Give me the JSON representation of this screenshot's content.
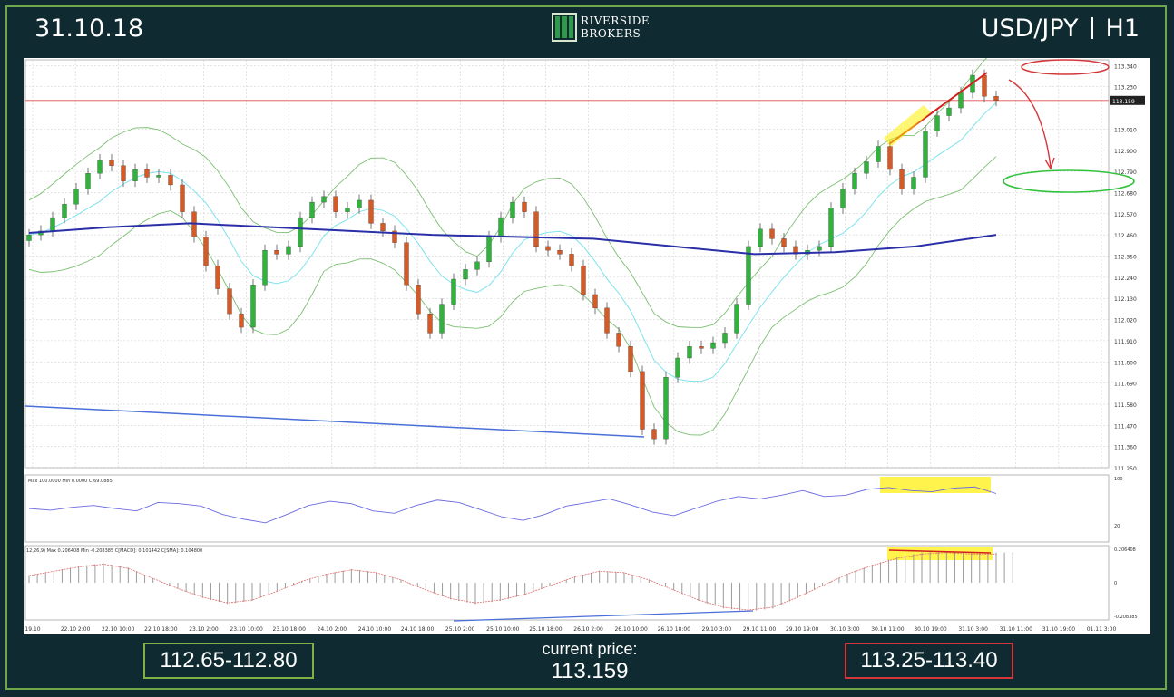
{
  "header": {
    "date": "31.10.18",
    "symbol": "USD/JPY",
    "timeframe": "H1"
  },
  "logo": {
    "line1": "RIVERSIDE",
    "line2": "BROKERS"
  },
  "footer": {
    "support_range": "112.65-112.80",
    "current_label": "current price:",
    "current_value": "113.159",
    "resistance_range": "113.25-113.40"
  },
  "colors": {
    "background": "#0f2a30",
    "frame": "#6ea84a",
    "bull": "#2fb33c",
    "bear": "#d65a26",
    "ma_long": "#2a2fa8",
    "ma_short": "#7fe3ec",
    "bands": "#7cbf72",
    "support_box": "#7fb043",
    "resistance_box": "#d4363a"
  },
  "chart_data": {
    "type": "line",
    "title": "",
    "y_ticks": [
      "113.340",
      "113.230",
      "113.159",
      "113.010",
      "112.900",
      "112.790",
      "112.680",
      "112.570",
      "112.460",
      "112.350",
      "112.240",
      "112.130",
      "112.020",
      "111.910",
      "111.800",
      "111.690",
      "111.580",
      "111.470",
      "111.360",
      "111.250"
    ],
    "x_ticks": [
      "19.10",
      "22.10 2:00",
      "22.10 10:00",
      "22.10 18:00",
      "23.10 2:00",
      "23.10 10:00",
      "23.10 18:00",
      "24.10 2:00",
      "24.10 10:00",
      "24.10 18:00",
      "25.10 2:00",
      "25.10 10:00",
      "25.10 18:00",
      "26.10 2:00",
      "26.10 10:00",
      "26.10 18:00",
      "29.10 3:00",
      "29.10 11:00",
      "29.10 19:00",
      "30.10 3:00",
      "30.10 11:00",
      "30.10 19:00",
      "31.10 3:00",
      "31.10 11:00",
      "31.10 19:00",
      "01.11 3:00"
    ],
    "ylim": [
      111.25,
      113.37
    ],
    "current_price": 113.159,
    "close_series": [
      112.46,
      112.48,
      112.55,
      112.62,
      112.7,
      112.78,
      112.85,
      112.82,
      112.74,
      112.8,
      112.76,
      112.77,
      112.72,
      112.58,
      112.45,
      112.3,
      112.18,
      112.05,
      111.98,
      112.2,
      112.38,
      112.36,
      112.4,
      112.55,
      112.63,
      112.66,
      112.58,
      112.6,
      112.64,
      112.52,
      112.48,
      112.42,
      112.2,
      112.05,
      111.95,
      112.1,
      112.23,
      112.28,
      112.32,
      112.45,
      112.55,
      112.63,
      112.58,
      112.4,
      112.38,
      112.36,
      112.3,
      112.15,
      112.08,
      111.95,
      111.88,
      111.75,
      111.45,
      111.4,
      111.72,
      111.82,
      111.88,
      111.87,
      111.9,
      111.95,
      112.1,
      112.4,
      112.49,
      112.44,
      112.4,
      112.36,
      112.38,
      112.4,
      112.6,
      112.7,
      112.78,
      112.84,
      112.92,
      112.8,
      112.7,
      112.76,
      113.0,
      113.08,
      113.12,
      113.2,
      113.29,
      113.18,
      113.159
    ],
    "ma_long": [
      112.47,
      112.5,
      112.52,
      112.5,
      112.48,
      112.46,
      112.45,
      112.44,
      112.4,
      112.36,
      112.37,
      112.4,
      112.46
    ],
    "rsi_header": "Max 100.0000  Min 0.0000  C:69.0885",
    "rsi_values": [
      50,
      47,
      52,
      55,
      50,
      46,
      60,
      58,
      54,
      40,
      32,
      26,
      40,
      55,
      62,
      58,
      46,
      42,
      55,
      64,
      60,
      48,
      36,
      30,
      40,
      54,
      60,
      66,
      56,
      44,
      38,
      50,
      62,
      70,
      66,
      72,
      80,
      70,
      72,
      82,
      85,
      80,
      78,
      84,
      86,
      75
    ],
    "rsi_ticks": [
      "100",
      "20"
    ],
    "macd_header": "12,26,9)  Max 0.206408  Min -0.208385  C[MACD]: 0.101442  C[SMA]: 0.104800",
    "macd_values": [
      0.05,
      0.08,
      0.11,
      0.13,
      0.1,
      0.03,
      -0.04,
      -0.1,
      -0.14,
      -0.12,
      -0.06,
      0.01,
      0.06,
      0.09,
      0.07,
      0.02,
      -0.05,
      -0.11,
      -0.14,
      -0.12,
      -0.08,
      -0.02,
      0.04,
      0.08,
      0.07,
      0.02,
      -0.05,
      -0.12,
      -0.17,
      -0.19,
      -0.17,
      -0.1,
      -0.02,
      0.06,
      0.12,
      0.17,
      0.2,
      0.21,
      0.2,
      0.2
    ],
    "macd_ticks": [
      "0.206408",
      "0",
      "-0.208385"
    ]
  }
}
